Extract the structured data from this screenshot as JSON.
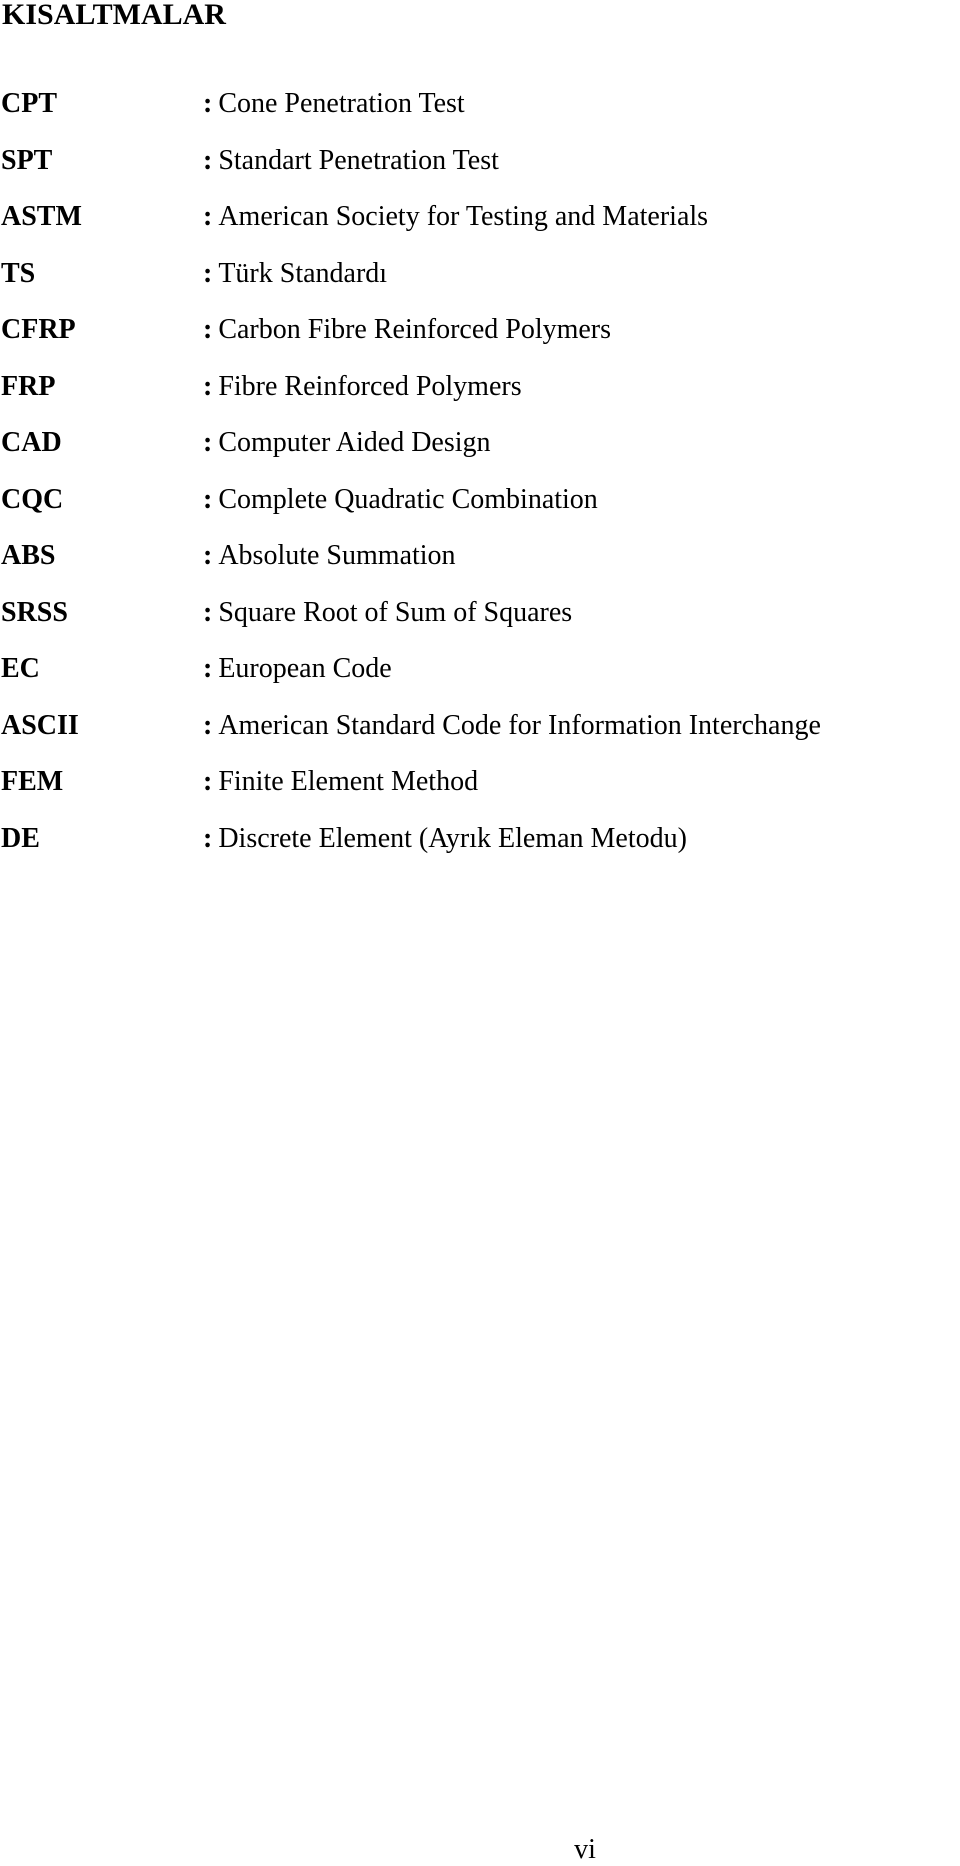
{
  "page": {
    "title": "KISALTMALAR",
    "page_number": "vi"
  },
  "abbreviations": [
    {
      "term": "CPT",
      "separator": ":",
      "definition": "Cone Penetration Test"
    },
    {
      "term": "SPT",
      "separator": ":",
      "definition": "Standart Penetration Test"
    },
    {
      "term": "ASTM",
      "separator": ":",
      "definition": "American Society for Testing and Materials"
    },
    {
      "term": "TS",
      "separator": ":",
      "definition": "Türk Standardı"
    },
    {
      "term": "CFRP",
      "separator": ":",
      "definition": "Carbon Fibre Reinforced Polymers"
    },
    {
      "term": "FRP",
      "separator": ":",
      "definition": "Fibre Reinforced Polymers"
    },
    {
      "term": "CAD",
      "separator": ":",
      "definition": "Computer Aided Design"
    },
    {
      "term": "CQC",
      "separator": ":",
      "definition": "Complete Quadratic Combination"
    },
    {
      "term": "ABS",
      "separator": ":",
      "definition": "Absolute Summation"
    },
    {
      "term": "SRSS",
      "separator": ":",
      "definition": "Square Root of Sum of Squares"
    },
    {
      "term": "EC",
      "separator": ":",
      "definition": "European Code"
    },
    {
      "term": "ASCII",
      "separator": ":",
      "definition": "American Standard Code for Information Interchange"
    },
    {
      "term": "FEM",
      "separator": ":",
      "definition": "Finite Element Method"
    },
    {
      "term": "DE",
      "separator": ":",
      "definition": "Discrete Element (Ayrık Eleman Metodu)"
    }
  ]
}
